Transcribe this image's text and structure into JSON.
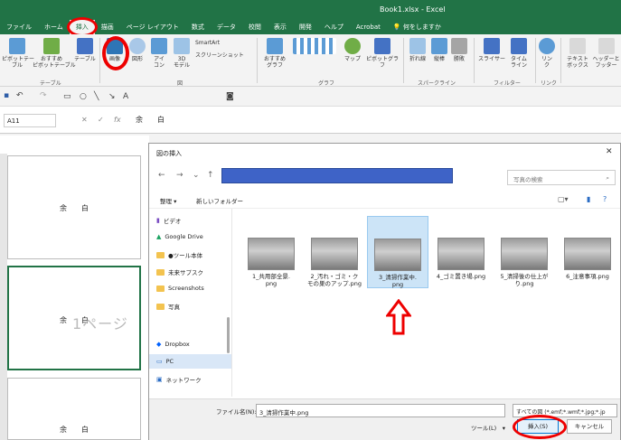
{
  "window": {
    "title": "Book1.xlsx  -  Excel"
  },
  "tabs": [
    "ファイル",
    "ホーム",
    "挿入",
    "描画",
    "ページ レイアウト",
    "数式",
    "データ",
    "校閲",
    "表示",
    "開発",
    "ヘルプ",
    "Acrobat",
    "何をしますか"
  ],
  "ribbon": {
    "pivot": "ピボットテー\nブル",
    "recommended_pivot": "おすすめ\nピボットテーブル",
    "table": "テーブル",
    "group_table": "テーブル",
    "picture": "画像",
    "shapes": "図形",
    "icons": "アイ\nコン",
    "model3d": "3D\nモデル",
    "smartart": "SmartArt",
    "screenshot": "スクリーンショット",
    "group_illust": "図",
    "recommended_chart": "おすすめ\nグラフ",
    "map": "マップ",
    "pivotchart": "ピボットグラフ",
    "group_chart": "グラフ",
    "line": "折れ線",
    "column": "縦棒",
    "winloss": "勝敗",
    "group_spark": "スパークライン",
    "slicer": "スライサー",
    "timeline": "タイム\nライン",
    "group_filter": "フィルター",
    "link": "リン\nク",
    "group_link": "リンク",
    "textbox": "テキスト\nボックス",
    "header": "ヘッダーと\nフッター"
  },
  "formula_bar": {
    "name_box": "A11",
    "content": "余　　白"
  },
  "sheet": {
    "cells": [
      "余　　白",
      "余　　白",
      "余　　白"
    ],
    "page_watermark": "1ページ"
  },
  "dialog": {
    "title": "図の挿入",
    "search_placeholder": "写真の検索",
    "organize": "整理 ▾",
    "new_folder": "新しいフォルダー",
    "nav_items": [
      "ビデオ",
      "Google Drive",
      "●ツール本体",
      "未来サプスク",
      "Screenshots",
      "写真",
      "Dropbox",
      "PC",
      "ネットワーク"
    ],
    "files": [
      {
        "name": "1_共用部全景.\npng",
        "selected": false
      },
      {
        "name": "2_汚れ・ゴミ・ク\nモの巣のアップ.png",
        "selected": false
      },
      {
        "name": "3_清掃作業中.\npng",
        "selected": true
      },
      {
        "name": "4_ゴミ置き場.png",
        "selected": false
      },
      {
        "name": "5_清掃後の仕上が\nり.png",
        "selected": false
      },
      {
        "name": "6_注意事項.png",
        "selected": false
      }
    ],
    "filename_label": "ファイル名(N):",
    "filename_value": "3_清掃作業中.png",
    "filetype": "すべての図 (*.emf;*.wmf;*.jpg;*.jp",
    "tools": "ツール(L)　▾",
    "insert": "挿入(S)",
    "cancel": "キャンセル"
  },
  "colors": {
    "excel_green": "#217346",
    "highlight_red": "#e00000",
    "address_blue": "#3e63c7"
  }
}
